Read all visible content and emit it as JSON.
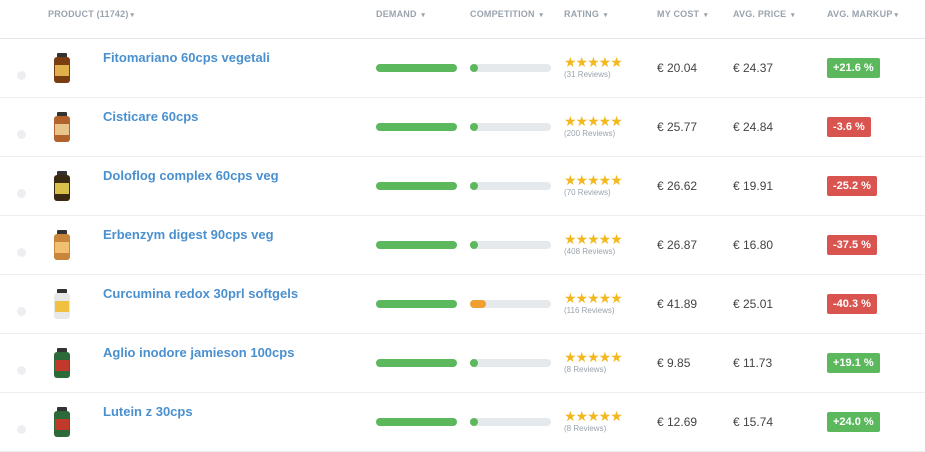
{
  "header": {
    "product": "PRODUCT (11742)",
    "demand": "DEMAND",
    "competition": "COMPETITION",
    "rating": "RATING",
    "my_cost": "MY COST",
    "avg_price": "AVG. PRICE",
    "avg_markup": "AVG. MARKUP"
  },
  "caret": "▾",
  "stars_text": "★★★★★",
  "colors": {
    "link": "#4a90cf",
    "green": "#5cb85c",
    "red": "#d9534f",
    "orange": "#f0a030",
    "star": "#f2b81e"
  },
  "rows": [
    {
      "name": "Fitomariano 60cps vegetali",
      "demand": 1.0,
      "competition": 0.08,
      "competition_color": "#5cb85c",
      "rating": 5,
      "reviews": "(31 Reviews)",
      "cost": "€ 20.04",
      "price": "€ 24.37",
      "markup": "+21.6 %",
      "markup_color": "#5cb85c",
      "bottle": "#7a3d12",
      "label": "#e0b14a"
    },
    {
      "name": "Cisticare 60cps",
      "demand": 1.0,
      "competition": 0.08,
      "competition_color": "#5cb85c",
      "rating": 5,
      "reviews": "(200 Reviews)",
      "cost": "€ 25.77",
      "price": "€ 24.84",
      "markup": "-3.6 %",
      "markup_color": "#d9534f",
      "bottle": "#b2632c",
      "label": "#e8c58a"
    },
    {
      "name": "Doloflog complex 60cps veg",
      "demand": 1.0,
      "competition": 0.08,
      "competition_color": "#5cb85c",
      "rating": 5,
      "reviews": "(70 Reviews)",
      "cost": "€ 26.62",
      "price": "€ 19.91",
      "markup": "-25.2 %",
      "markup_color": "#d9534f",
      "bottle": "#3a2a12",
      "label": "#d8c04a"
    },
    {
      "name": "Erbenzym digest 90cps veg",
      "demand": 1.0,
      "competition": 0.08,
      "competition_color": "#5cb85c",
      "rating": 5,
      "reviews": "(408 Reviews)",
      "cost": "€ 26.87",
      "price": "€ 16.80",
      "markup": "-37.5 %",
      "markup_color": "#d9534f",
      "bottle": "#c9853a",
      "label": "#f0c070"
    },
    {
      "name": "Curcumina redox 30prl softgels",
      "demand": 1.0,
      "competition": 0.2,
      "competition_color": "#f0a030",
      "rating": 5,
      "reviews": "(116 Reviews)",
      "cost": "€ 41.89",
      "price": "€ 25.01",
      "markup": "-40.3 %",
      "markup_color": "#d9534f",
      "bottle": "#e8e8e8",
      "label": "#f0c040"
    },
    {
      "name": "Aglio inodore jamieson 100cps",
      "demand": 1.0,
      "competition": 0.08,
      "competition_color": "#5cb85c",
      "rating": 5,
      "reviews": "(8 Reviews)",
      "cost": "€ 9.85",
      "price": "€ 11.73",
      "markup": "+19.1 %",
      "markup_color": "#5cb85c",
      "bottle": "#2d6a3a",
      "label": "#c0392b"
    },
    {
      "name": "Lutein z 30cps",
      "demand": 1.0,
      "competition": 0.08,
      "competition_color": "#5cb85c",
      "rating": 5,
      "reviews": "(8 Reviews)",
      "cost": "€ 12.69",
      "price": "€ 15.74",
      "markup": "+24.0 %",
      "markup_color": "#5cb85c",
      "bottle": "#2d6a3a",
      "label": "#c0392b"
    }
  ]
}
